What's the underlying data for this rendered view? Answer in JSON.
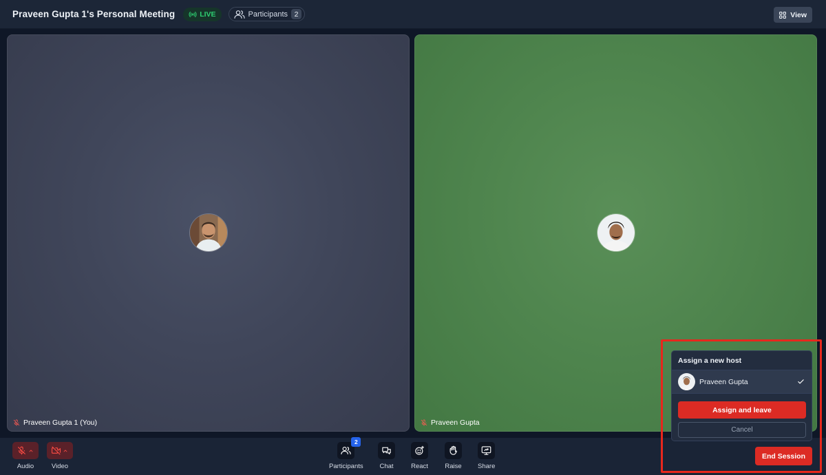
{
  "header": {
    "meeting_title": "Praveen Gupta 1's Personal Meeting",
    "live_label": "LIVE",
    "participants_label": "Participants",
    "participants_count": "2",
    "view_label": "View"
  },
  "tiles": [
    {
      "name": "Praveen Gupta 1 (You)",
      "muted": true,
      "bg_color": "#40465a"
    },
    {
      "name": "Praveen Gupta",
      "muted": true,
      "bg_color": "#4f854e"
    }
  ],
  "toolbar": {
    "audio_label": "Audio",
    "video_label": "Video",
    "participants_label": "Participants",
    "participants_badge": "2",
    "chat_label": "Chat",
    "react_label": "React",
    "raise_label": "Raise",
    "share_label": "Share",
    "end_session_label": "End Session"
  },
  "assign_host": {
    "title": "Assign a new host",
    "option_name": "Praveen Gupta",
    "option_selected": true,
    "assign_label": "Assign and leave",
    "cancel_label": "Cancel"
  },
  "colors": {
    "accent_red": "#dc2b24",
    "live_green": "#2ecf71",
    "badge_blue": "#2563eb",
    "highlight": "#e8271d"
  },
  "icons": [
    "broadcast-icon",
    "users-icon",
    "grid-icon",
    "mic-off-icon",
    "video-off-icon",
    "chevron-up-icon",
    "chat-icon",
    "emoji-icon",
    "hand-icon",
    "share-screen-icon",
    "check-icon"
  ]
}
